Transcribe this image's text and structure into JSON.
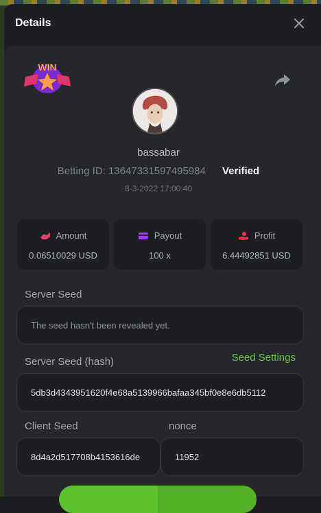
{
  "modal": {
    "title": "Details"
  },
  "bet": {
    "username": "bassabar",
    "betting_id_label": "Betting ID:",
    "betting_id": "13647331597495984",
    "verified": "Verified",
    "datetime": "8-3-2022 17:00:40",
    "badge_text": "WIN"
  },
  "stats": {
    "amount": {
      "label": "Amount",
      "value": "0.06510029 USD",
      "icon": "wallet-hand-icon"
    },
    "payout": {
      "label": "Payout",
      "value": "100 x",
      "icon": "card-icon"
    },
    "profit": {
      "label": "Profit",
      "value": "6.44492851 USD",
      "icon": "coin-hand-icon"
    }
  },
  "seeds": {
    "server_seed_label": "Server Seed",
    "server_seed_value": "The seed hasn't been revealed yet.",
    "server_seed_hash_label": "Server Seed (hash)",
    "seed_settings_link": "Seed Settings",
    "server_seed_hash_value": "5db3d4343951620f4e68a5139966bafaa345bf0e8e6db5112",
    "client_seed_label": "Client Seed",
    "client_seed_value": "8d4a2d517708b4153616de",
    "nonce_label": "nonce",
    "nonce_value": "11952"
  },
  "colors": {
    "accent_green": "#6bc33b",
    "amount_icon": "#e0446b",
    "payout_icon": "#9b3ff0",
    "profit_icon": "#e0344b"
  }
}
